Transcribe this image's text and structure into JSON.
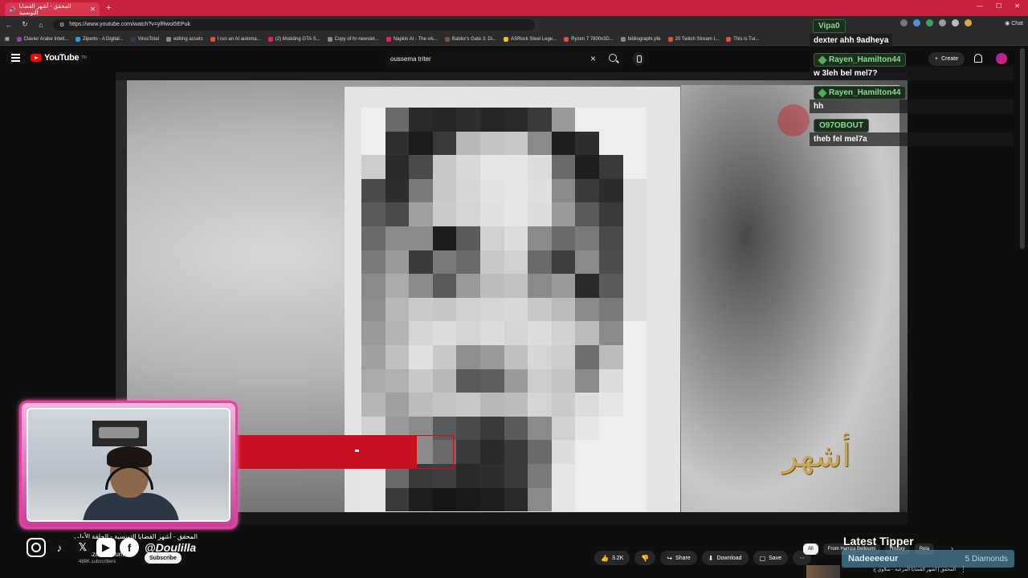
{
  "browser": {
    "tab_title": "المحقق - أشهر القضايا التونسية",
    "url": "https://www.youtube.com/watch?v=ylRwoi5EPuk",
    "chat_button": "Chat",
    "bookmarks": [
      {
        "label": "Clavier Arabe Intell...",
        "color": "#8e44ad"
      },
      {
        "label": "Ziperto - A Digital...",
        "color": "#3498db"
      },
      {
        "label": "VirusTotal",
        "color": "#2c3e50"
      },
      {
        "label": "editing assets",
        "color": "#888888"
      },
      {
        "label": "I run an AI automa...",
        "color": "#e74c3c"
      },
      {
        "label": "(2) Modding GTA S...",
        "color": "#e91e63"
      },
      {
        "label": "Copy of hr-newslet...",
        "color": "#888888"
      },
      {
        "label": "Napkin AI - The vis...",
        "color": "#e91e63"
      },
      {
        "label": "Baldur's Gate 3: Di...",
        "color": "#795548"
      },
      {
        "label": "ASRock Steel Lege...",
        "color": "#f1c40f"
      },
      {
        "label": "Ryzen 7 7800x3D...",
        "color": "#e74c3c"
      },
      {
        "label": "bibliographi pfe",
        "color": "#888888"
      },
      {
        "label": "20 Twitch Stream I...",
        "color": "#e74c3c"
      },
      {
        "label": "This is Tur...",
        "color": "#e74c3c"
      }
    ]
  },
  "youtube": {
    "logo_text": "YouTube",
    "logo_region": "TN",
    "search_value": "oussema triter",
    "create_label": "Create"
  },
  "chat": {
    "line1_name": "Vipa0",
    "line1_text": "dexter ahh 9adheya",
    "msg2_name": "Rayen_Hamilton44",
    "msg2_text": "w 3leh bel mel7?",
    "msg3_name": "Rayen_Hamilton44",
    "msg3_text": "hh",
    "msg4_name": "O97OBOUT",
    "msg4_text": "theb fel mel7a"
  },
  "video": {
    "title": "المحقق - أشهر القضايا التونسية - الحلقة الأولى",
    "channel": "Hamza Belloumi",
    "subscribers": "488K subscribers",
    "subscribe_label": "Subscribe",
    "likes": "3.2K",
    "share_label": "Share",
    "download_label": "Download",
    "save_label": "Save"
  },
  "stream_overlay": {
    "handle": "@Doulilla",
    "latest_tipper_title": "Latest Tipper",
    "tipper_name": "Nadeeeeeur",
    "tipper_amount": "5 Diamonds"
  },
  "sidebar_chips": {
    "all": "All",
    "from_channel": "From Hamza Belloumi",
    "history": "History",
    "related": "Rela"
  },
  "recommended": {
    "title": "المحقق | أشهر القضايا المرعبة - سلاوي ج"
  },
  "colors": {
    "tabbar": "#c8203f",
    "yt_red": "#ff0000",
    "overlay_pink": "#e640a3",
    "chat_name_green": "#7de08a"
  }
}
